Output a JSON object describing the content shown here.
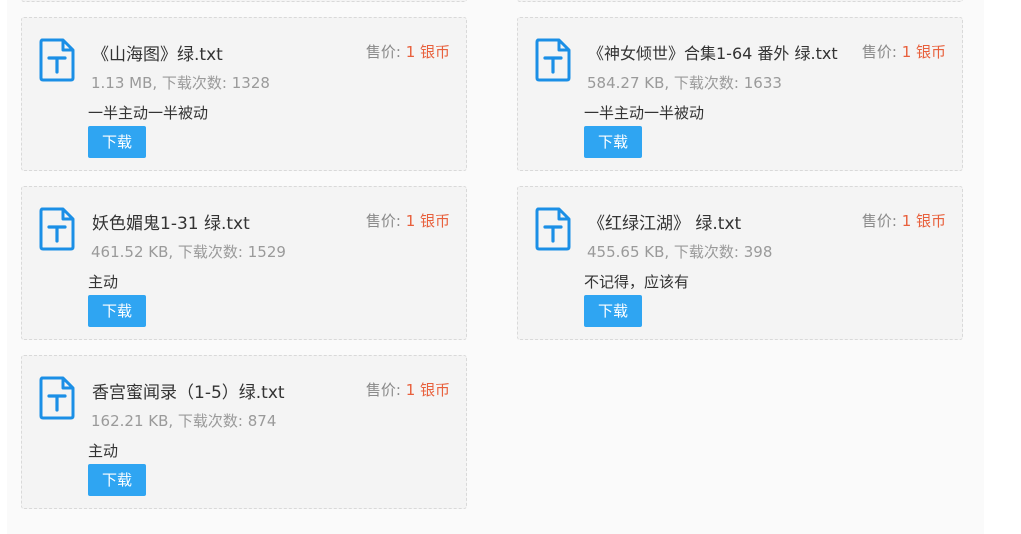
{
  "accent_color": "#2fa5f2",
  "price_color": "#e8603c",
  "icon": "text-file-icon",
  "attachments": [
    {
      "title": "《山海图》绿.txt",
      "meta": "1.13 MB, 下载次数: 1328",
      "price_label": "售价:",
      "price_amount": "1 银币",
      "note": "一半主动一半被动",
      "button_label": "下载"
    },
    {
      "title": "《神女倾世》合集1-64 番外 绿.txt",
      "meta": "584.27 KB, 下载次数: 1633",
      "price_label": "售价:",
      "price_amount": "1 银币",
      "note": "一半主动一半被动",
      "button_label": "下载"
    },
    {
      "title": "妖色媚鬼1-31 绿.txt",
      "meta": "461.52 KB, 下载次数: 1529",
      "price_label": "售价:",
      "price_amount": "1 银币",
      "note": "主动",
      "button_label": "下载"
    },
    {
      "title": "《红绿江湖》 绿.txt",
      "meta": "455.65 KB, 下载次数: 398",
      "price_label": "售价:",
      "price_amount": "1 银币",
      "note": "不记得，应该有",
      "button_label": "下载"
    },
    {
      "title": "香宫蜜闻录（1-5）绿.txt",
      "meta": "162.21 KB, 下载次数: 874",
      "price_label": "售价:",
      "price_amount": "1 银币",
      "note": "主动",
      "button_label": "下载"
    }
  ]
}
